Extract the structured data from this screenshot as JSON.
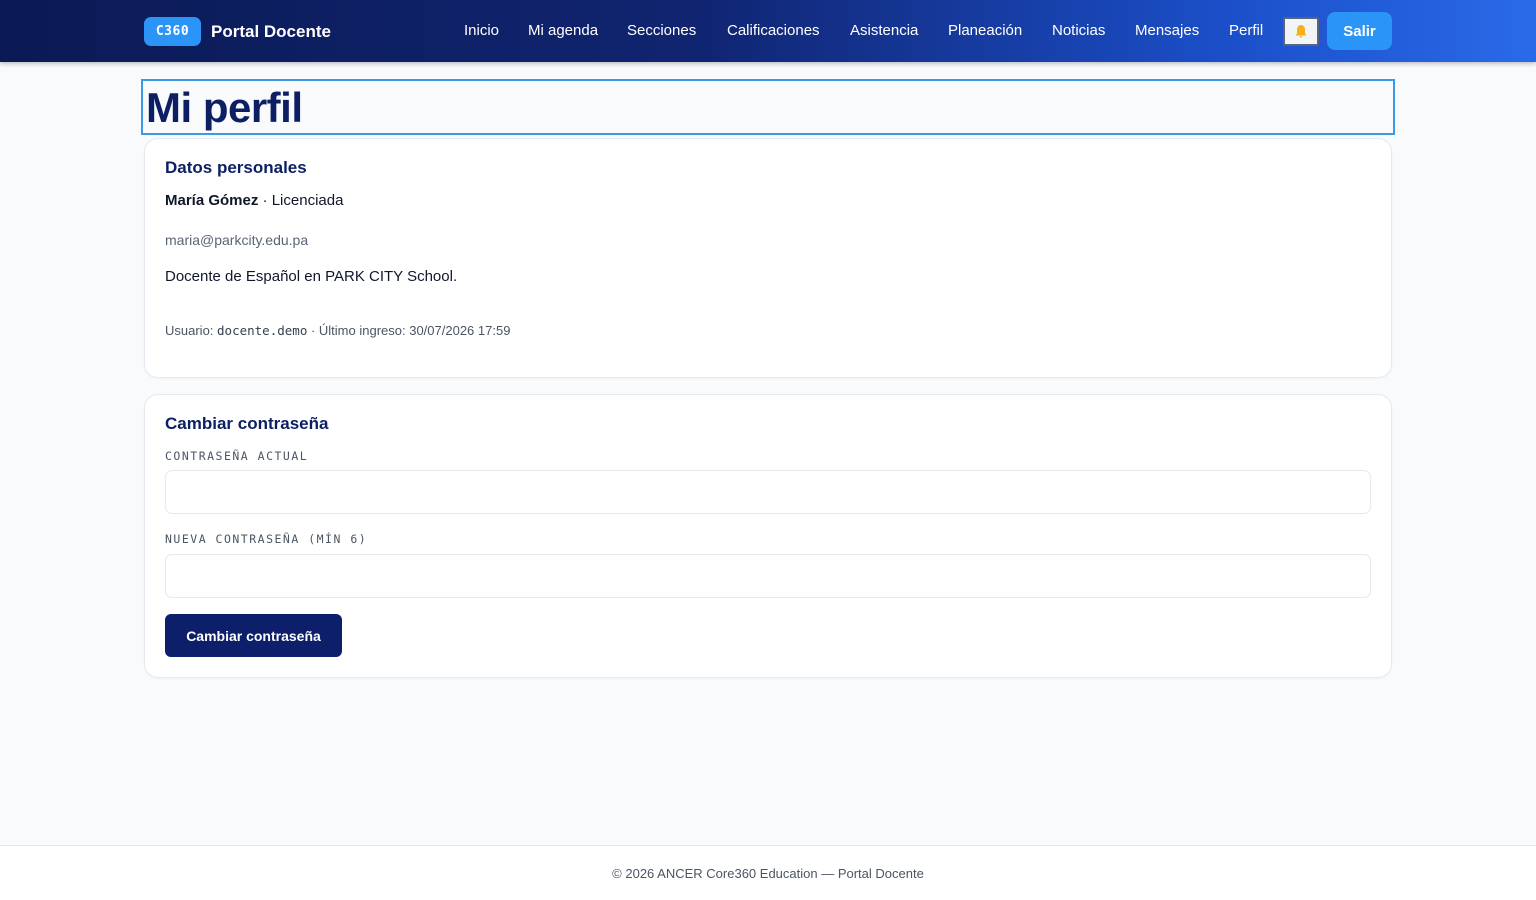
{
  "header": {
    "brand_badge": "C360",
    "brand_title": "Portal Docente",
    "nav": [
      {
        "id": "inicio",
        "label": "Inicio"
      },
      {
        "id": "agenda",
        "label": "Mi agenda"
      },
      {
        "id": "secciones",
        "label": "Secciones"
      },
      {
        "id": "calificaciones",
        "label": "Calificaciones"
      },
      {
        "id": "asistencia",
        "label": "Asistencia"
      },
      {
        "id": "planeacion",
        "label": "Planeación"
      },
      {
        "id": "noticias",
        "label": "Noticias"
      },
      {
        "id": "mensajes",
        "label": "Mensajes"
      },
      {
        "id": "perfil",
        "label": "Perfil"
      }
    ],
    "notifications_icon": "bell-icon",
    "logout_label": "Salir"
  },
  "page": {
    "title": "Mi perfil"
  },
  "personal": {
    "heading": "Datos personales",
    "name": "María Gómez",
    "separator": " · ",
    "degree": "Licenciada",
    "email": "maria@parkcity.edu.pa",
    "bio": "Docente de Español en PARK CITY School.",
    "user_label": "Usuario: ",
    "username": "docente.demo",
    "last_login_label": " · Último ingreso: ",
    "last_login": "30/07/2026 17:59"
  },
  "password": {
    "heading": "Cambiar contraseña",
    "current_label": "CONTRASEÑA ACTUAL",
    "current_value": "",
    "new_label": "NUEVA CONTRASEÑA (MÍN 6)",
    "new_value": "",
    "submit_label": "Cambiar contraseña"
  },
  "footer": {
    "text": "© 2026 ANCER Core360 Education — Portal Docente"
  },
  "colors": {
    "header_start": "#0b1a55",
    "header_end": "#2a6ae8",
    "accent": "#2b95f7",
    "primary": "#0d1f6b"
  }
}
